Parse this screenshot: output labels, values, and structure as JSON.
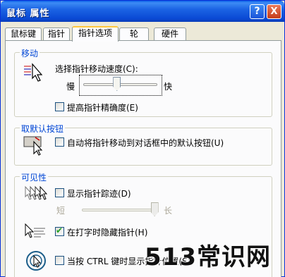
{
  "window": {
    "title": "鼠标 属性",
    "help_label": "?",
    "close_label": "X"
  },
  "tabs": [
    {
      "label": "鼠标键",
      "active": false
    },
    {
      "label": "指针",
      "active": false
    },
    {
      "label": "指针选项",
      "active": true
    },
    {
      "label": "轮",
      "active": false
    },
    {
      "label": "硬件",
      "active": false
    }
  ],
  "motion": {
    "group_label": "移动",
    "speed_label": "选择指针移动速度(C):",
    "slow_label": "慢",
    "fast_label": "快",
    "speed_level": 0.45,
    "precision_label": "提高指针精确度(E)",
    "precision_checked": false
  },
  "snap_to": {
    "group_label": "取默认按钮",
    "auto_label": "自动将指针移动到对话框中的默认按钮(U)",
    "auto_checked": false
  },
  "visibility": {
    "group_label": "可见性",
    "trails_label": "显示指针踪迹(D)",
    "trails_checked": false,
    "short_label": "短",
    "long_label": "长",
    "trails_level": 0.95,
    "hide_typing_label": "在打字时隐藏指针(H)",
    "hide_typing_checked": true,
    "ctrl_label": "当按 CTRL 键时显示指针位置(S)",
    "ctrl_checked": false
  },
  "watermark": "513常识网"
}
